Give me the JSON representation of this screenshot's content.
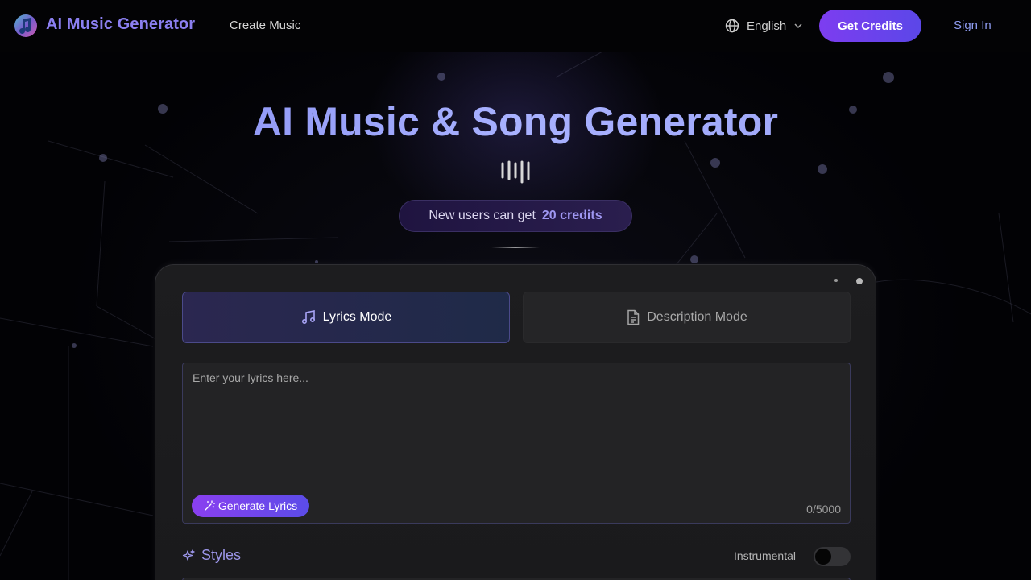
{
  "header": {
    "brand": "AI Music Generator",
    "nav_create": "Create Music",
    "language": "English",
    "get_credits": "Get Credits",
    "sign_in": "Sign In"
  },
  "hero": {
    "title": "AI Music & Song Generator",
    "promo_prefix": "New users can get",
    "promo_highlight": "20 credits"
  },
  "modes": {
    "lyrics": "Lyrics Mode",
    "description": "Description Mode",
    "active": "lyrics"
  },
  "lyrics": {
    "placeholder": "Enter your lyrics here...",
    "value": "",
    "generate_button": "Generate Lyrics",
    "counter": "0/5000"
  },
  "styles": {
    "label": "Styles",
    "instrumental_label": "Instrumental",
    "instrumental_on": false
  },
  "colors": {
    "accent": "#7d3df0",
    "brand_text": "#8b7ff0",
    "link": "#8e9bf0"
  },
  "icons": {
    "logo": "music-note-logo",
    "language": "globe-icon",
    "dropdown": "chevron-down-icon",
    "lyrics_mode": "music-note-icon",
    "description_mode": "document-icon",
    "generate_lyrics": "magic-wand-icon",
    "styles": "sparkles-icon"
  }
}
